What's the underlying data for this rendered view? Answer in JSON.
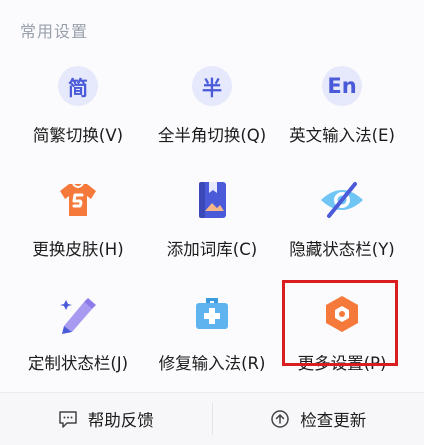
{
  "section": {
    "title": "常用设置"
  },
  "colors": {
    "accent": "#4a5ad8",
    "orange": "#f5793b",
    "highlight": "#d81e1e",
    "badge_bg": "#e6e8fb"
  },
  "items": [
    {
      "label": "简繁切换(V)",
      "icon": "simplified-traditional-icon",
      "glyph": "简"
    },
    {
      "label": "全半角切换(Q)",
      "icon": "full-half-width-icon",
      "glyph": "半"
    },
    {
      "label": "英文输入法(E)",
      "icon": "english-input-icon",
      "glyph": "En"
    },
    {
      "label": "更换皮肤(H)",
      "icon": "skin-shirt-icon",
      "glyph": ""
    },
    {
      "label": "添加词库(C)",
      "icon": "dictionary-book-icon",
      "glyph": ""
    },
    {
      "label": "隐藏状态栏(Y)",
      "icon": "hide-eye-icon",
      "glyph": ""
    },
    {
      "label": "定制状态栏(J)",
      "icon": "customize-pen-icon",
      "glyph": ""
    },
    {
      "label": "修复输入法(R)",
      "icon": "repair-kit-icon",
      "glyph": ""
    },
    {
      "label": "更多设置(P)",
      "icon": "more-settings-hex-icon",
      "glyph": ""
    }
  ],
  "footer": {
    "help_label": "帮助反馈",
    "update_label": "检查更新"
  }
}
